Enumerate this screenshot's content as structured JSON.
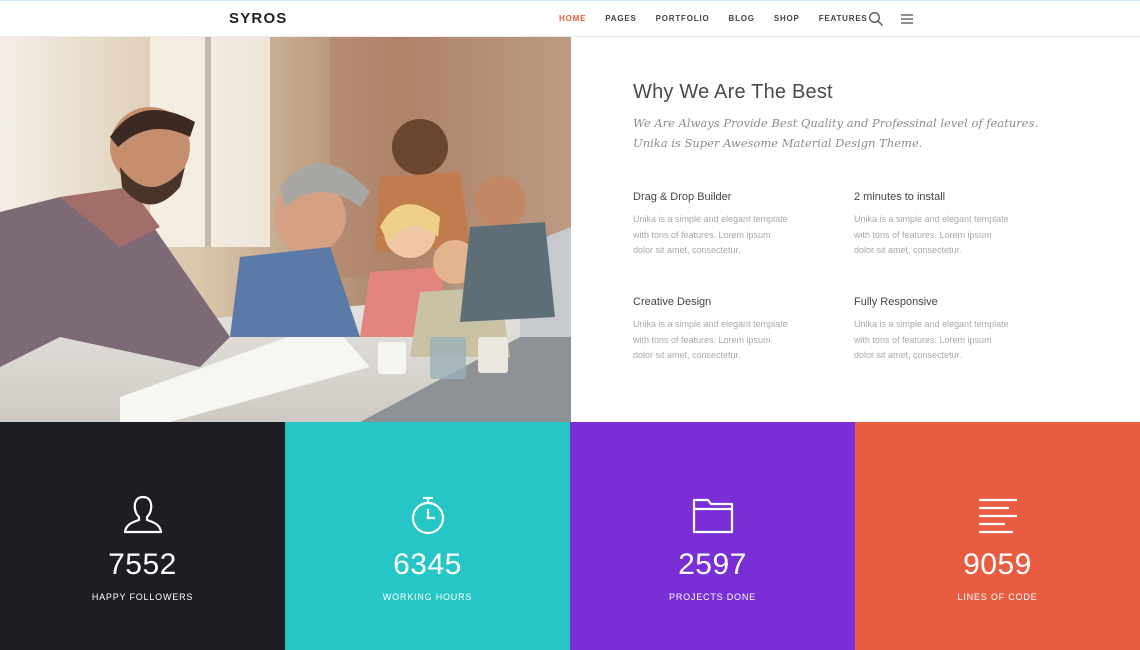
{
  "header": {
    "logo": "SYROS",
    "nav": [
      "HOME",
      "PAGES",
      "PORTFOLIO",
      "BLOG",
      "SHOP",
      "FEATURES"
    ],
    "active": "HOME",
    "icons": [
      "search-icon",
      "hamburger-menu-icon"
    ],
    "accent_color": "#e8603c"
  },
  "features": {
    "title": "Why We Are The Best",
    "subtitle_line1": "We Are Always Provide Best Quality and Professinal level of features.",
    "subtitle_line2": "Unika is Super Awesome Material Design Theme.",
    "items": [
      {
        "title": "Drag & Drop Builder",
        "line1": "Unika is a simple and elegant template",
        "line2": "with tons of features. Lorem ipsum",
        "line3": "dolor sit amet, consectetur."
      },
      {
        "title": "2 minutes to install",
        "line1": "Unika is a simple and elegant template",
        "line2": "with tons of features. Lorem ipsum",
        "line3": "dolor sit amet, consectetur."
      },
      {
        "title": "Creative Design",
        "line1": "Unika is a simple and elegant template",
        "line2": "with tons of features. Lorem ipsum",
        "line3": "dolor sit amet, consectetur."
      },
      {
        "title": "Fully Responsive",
        "line1": "Unika is a simple and elegant template",
        "line2": "with tons of features. Lorem ipsum",
        "line3": "dolor sit amet, consectetur."
      }
    ]
  },
  "stats": [
    {
      "number": "7552",
      "label": "HAPPY FOLLOWERS",
      "icon": "user-icon",
      "color": "#1c1e24"
    },
    {
      "number": "6345",
      "label": "WORKING HOURS",
      "icon": "stopwatch-icon",
      "color": "#26c6c6"
    },
    {
      "number": "2597",
      "label": "PROJECTS DONE",
      "icon": "folder-icon",
      "color": "#7a2ed6"
    },
    {
      "number": "9059",
      "label": "LINES OF CODE",
      "icon": "text-lines-icon",
      "color": "#e85c42"
    }
  ]
}
